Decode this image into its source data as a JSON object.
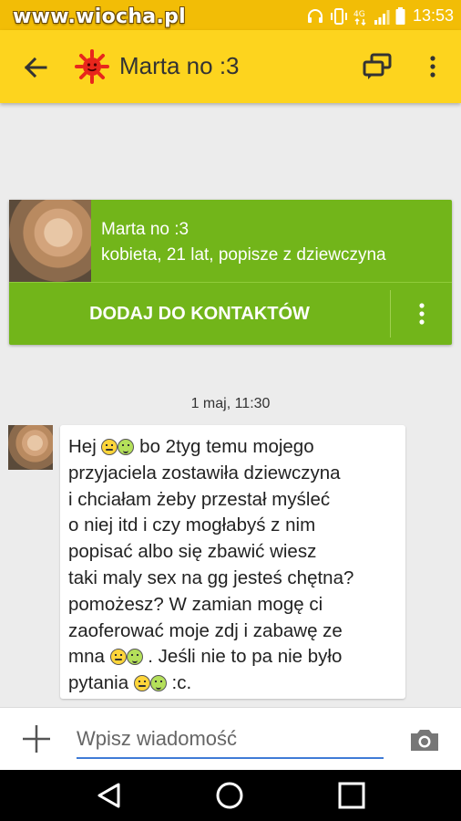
{
  "watermark": "www.wiocha.pl",
  "status": {
    "time": "13:53",
    "icons": [
      "headset-icon",
      "vibrate-icon",
      "lte-icon",
      "signal-icon",
      "battery-icon"
    ]
  },
  "header": {
    "title": "Marta no :3",
    "back_icon": "arrow-left-icon",
    "avatar_icon": "sun-icon",
    "actions": [
      "contacts-icon",
      "more-vertical-icon"
    ],
    "colors": {
      "appbar": "#fdd41e",
      "statusbar": "#f2bd06"
    }
  },
  "profile_card": {
    "name": "Marta no :3",
    "description": "kobieta, 21 lat, popisze z dziewczyna",
    "add_label": "DODAJ DO KONTAKTÓW",
    "color": "#72b51a"
  },
  "chat": {
    "date": "1 maj, 11:30",
    "message_lines": [
      [
        {
          "t": "Hej "
        },
        {
          "e": "a"
        },
        {
          "e": "b"
        },
        {
          "t": " bo 2tyg temu  mojego"
        }
      ],
      [
        {
          "t": "przyjaciela zostawiła dziewczyna"
        }
      ],
      [
        {
          "t": "i chciałam żeby przestał myśleć"
        }
      ],
      [
        {
          "t": "o niej itd i czy mogłabyś z nim"
        }
      ],
      [
        {
          "t": "popisać albo się zbawić wiesz"
        }
      ],
      [
        {
          "t": "taki maly sex na gg jesteś chętna?"
        }
      ],
      [
        {
          "t": "pomożesz?  W zamian mogę ci"
        }
      ],
      [
        {
          "t": "zaoferować moje zdj i zabawę ze"
        }
      ],
      [
        {
          "t": "mna "
        },
        {
          "e": "a"
        },
        {
          "e": "b"
        },
        {
          "t": " . Jeśli nie to pa nie było"
        }
      ],
      [
        {
          "t": "pytania "
        },
        {
          "e": "a"
        },
        {
          "e": "b"
        },
        {
          "t": " :c."
        }
      ]
    ]
  },
  "composer": {
    "placeholder": "Wpisz wiadomość",
    "value": ""
  },
  "navbar": {
    "items": [
      "back-triangle-icon",
      "home-circle-icon",
      "recents-square-icon"
    ]
  }
}
